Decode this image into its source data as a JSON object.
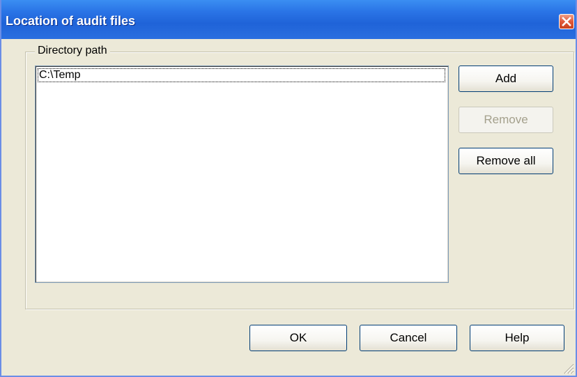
{
  "window": {
    "title": "Location of audit files"
  },
  "icons": {
    "close": "close-icon",
    "grip": "resize-grip-icon"
  },
  "group": {
    "label": "Directory path"
  },
  "list": {
    "items": [
      "C:\\Temp"
    ]
  },
  "side_buttons": {
    "add": "Add",
    "remove": "Remove",
    "remove_all": "Remove all"
  },
  "footer": {
    "ok": "OK",
    "cancel": "Cancel",
    "help": "Help"
  },
  "colors": {
    "titlebar": "#2a6fe0",
    "dialog_bg": "#ece9d8",
    "close_button": "#e0593a"
  }
}
